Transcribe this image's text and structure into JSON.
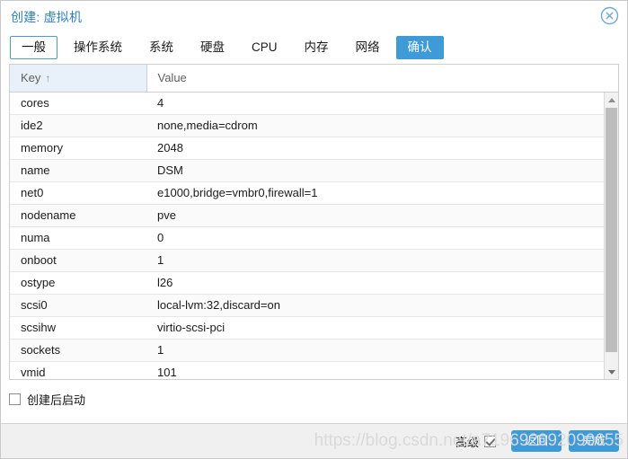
{
  "window": {
    "title": "创建: 虚拟机",
    "close_icon": "close-circle-icon"
  },
  "tabs": [
    {
      "label": "一般",
      "state": "outlined"
    },
    {
      "label": "操作系统",
      "state": "normal"
    },
    {
      "label": "系统",
      "state": "normal"
    },
    {
      "label": "硬盘",
      "state": "normal"
    },
    {
      "label": "CPU",
      "state": "normal"
    },
    {
      "label": "内存",
      "state": "normal"
    },
    {
      "label": "网络",
      "state": "normal"
    },
    {
      "label": "确认",
      "state": "active"
    }
  ],
  "grid": {
    "columns": [
      {
        "label": "Key",
        "sorted": "asc",
        "sort_glyph": "↑"
      },
      {
        "label": "Value",
        "sorted": "none",
        "sort_glyph": ""
      }
    ],
    "rows": [
      {
        "key": "cores",
        "value": "4"
      },
      {
        "key": "ide2",
        "value": "none,media=cdrom"
      },
      {
        "key": "memory",
        "value": "2048"
      },
      {
        "key": "name",
        "value": "DSM"
      },
      {
        "key": "net0",
        "value": "e1000,bridge=vmbr0,firewall=1"
      },
      {
        "key": "nodename",
        "value": "pve"
      },
      {
        "key": "numa",
        "value": "0"
      },
      {
        "key": "onboot",
        "value": "1"
      },
      {
        "key": "ostype",
        "value": "l26"
      },
      {
        "key": "scsi0",
        "value": "local-lvm:32,discard=on"
      },
      {
        "key": "scsihw",
        "value": "virtio-scsi-pci"
      },
      {
        "key": "sockets",
        "value": "1"
      },
      {
        "key": "vmid",
        "value": "101"
      }
    ]
  },
  "start_after_create": {
    "label": "创建后启动",
    "checked": false
  },
  "footer": {
    "advanced_label": "高级",
    "advanced_checked": true,
    "back_label": "返回",
    "finish_label": "完成"
  },
  "watermark": {
    "text": "https://blog.csdn.net/a719692092090655"
  },
  "colors": {
    "accent": "#3f9ad8",
    "title": "#2e7fc4",
    "header_sorted_bg": "#e8f1fa",
    "row_alt_bg": "#fafafa",
    "footer_bg": "#f0f0f0",
    "border": "#cfcfcf"
  }
}
